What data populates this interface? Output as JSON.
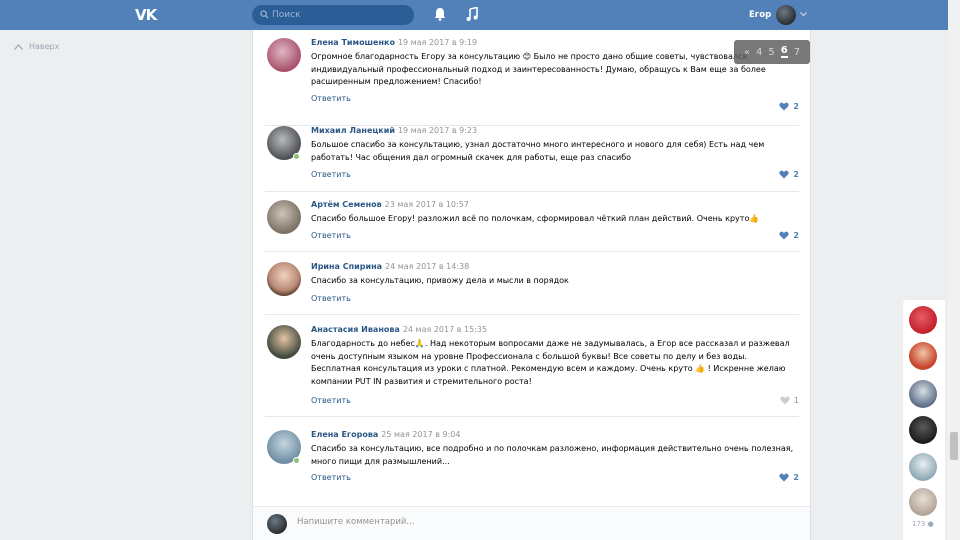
{
  "header": {
    "logo": "VK",
    "search_placeholder": "Поиск",
    "username": "Егор"
  },
  "nav": {
    "back_label": "Наверх"
  },
  "pager": {
    "pages": [
      "«",
      "4",
      "5",
      "6",
      "7"
    ],
    "current": "6"
  },
  "comments": [
    {
      "author": "Елена Тимошенко",
      "date": "19 мая 2017 в 9:19",
      "text": "Огромное благодарность Егору за консультацию 😊 Было не просто дано общие советы, чувствовался индивидуальный профессиональный подход и заинтересованность! Думаю, обращусь к Вам еще за более расширенным предложением! Спасибо!",
      "reply": "Ответить",
      "likes": "2",
      "online": false,
      "avatar_color": "#a8506a"
    },
    {
      "author": "Михаил Ланецкий",
      "date": "19 мая 2017 в 9:23",
      "text": "Большое спасибо за консультацию, узнал достаточно много интересного и нового для себя) Есть над чем работать! Час общения дал огромный скачек для работы, еще раз спасибо",
      "reply": "Ответить",
      "likes": "2",
      "online": true,
      "avatar_color": "#4d4f52"
    },
    {
      "author": "Артём Семенов",
      "date": "23 мая 2017 в 10:57",
      "text": "Спасибо большое Егору! разложил всё по полочкам, сформировал чёткий план действий. Очень круто👍",
      "reply": "Ответить",
      "likes": "2",
      "online": false,
      "avatar_color": "#7a6f63"
    },
    {
      "author": "Ирина Спирина",
      "date": "24 мая 2017 в 14:38",
      "text": "Спасибо за консультацию, привожу дела и мысли в порядок",
      "reply": "Ответить",
      "likes": "",
      "online": false,
      "avatar_color": "#b98a75"
    },
    {
      "author": "Анастасия Иванова",
      "date": "24 мая 2017 в 15:35",
      "text": "Благодарность до небес🙏. Над некоторым вопросами даже не задумывалась, а Егор все рассказал и разжевал очень доступным языком на уровне Профессионала с большой буквы! Все советы по делу и без воды. Бесплатная консультация из уроки с платной. Рекомендую всем и каждому. Очень круто 👍 ! Искренне желаю компании PUT IN развития и стремительного роста!",
      "reply": "Ответить",
      "likes": "1",
      "online": false,
      "avatar_color": "#3f4a3d"
    },
    {
      "author": "Елена Егорова",
      "date": "25 мая 2017 в 9:04",
      "text": "Спасибо за консультацию, все подробно и по полочкам разложено, информация действительно очень полезная, много пищи для размышлений...",
      "reply": "Ответить",
      "likes": "2",
      "online": true,
      "avatar_color": "#6f8fa5"
    }
  ],
  "compose": {
    "placeholder": "Напишите комментарий..."
  },
  "right_panel": {
    "avatar_colors": [
      "#c21f2a",
      "#c8462e",
      "#5c6f86",
      "#1c1c1c",
      "#8fa9b5",
      "#b3a397"
    ],
    "count": "173"
  }
}
